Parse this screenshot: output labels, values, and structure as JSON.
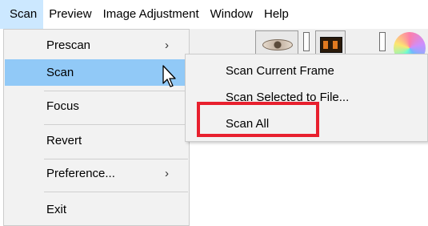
{
  "menubar": {
    "items": [
      {
        "label": "Scan"
      },
      {
        "label": "Preview"
      },
      {
        "label": "Image Adjustment"
      },
      {
        "label": "Window"
      },
      {
        "label": "Help"
      }
    ]
  },
  "scan_menu": {
    "items": [
      {
        "label": "Prescan",
        "arrow": "›"
      },
      {
        "label": "Scan",
        "arrow": "›"
      },
      {
        "label": "Focus"
      },
      {
        "label": "Revert"
      },
      {
        "label": "Preference...",
        "arrow": "›"
      },
      {
        "label": "Exit"
      }
    ]
  },
  "scan_submenu": {
    "items": [
      {
        "label": "Scan Current Frame"
      },
      {
        "label": "Scan Selected to File..."
      },
      {
        "label": "Scan All"
      }
    ]
  },
  "colors": {
    "menubar_active": "#cce8ff",
    "menu_hover": "#91c9f7",
    "highlight_box": "#e8202e"
  }
}
